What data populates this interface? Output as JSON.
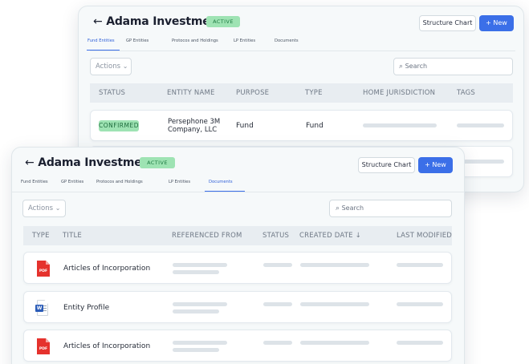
{
  "back_card": {
    "title": "Adama Investments",
    "back_arrow": "←",
    "badge": "ACTIVE",
    "structure_chart_label": "Structure Chart",
    "new_label": "+ New",
    "tabs": [
      {
        "label": "Fund Entities",
        "active": true
      },
      {
        "label": "GP Entities",
        "active": false
      },
      {
        "label": "Protocos and Holdings",
        "active": false
      },
      {
        "label": "LP Entities",
        "active": false
      },
      {
        "label": "Documents",
        "active": false
      }
    ],
    "actions_label": "Actions",
    "actions_chevron": "⌄",
    "search_icon": "⌕",
    "search_placeholder": "Search",
    "columns": [
      "STATUS",
      "ENTITY NAME",
      "PURPOSE",
      "TYPE",
      "HOME JURISDICTION",
      "TAGS"
    ],
    "rows": [
      {
        "status": "CONFIRMED",
        "entity_name_line1": "Persephone 3M",
        "entity_name_line2": "Company, LLC",
        "purpose": "Fund",
        "type": "Fund"
      }
    ]
  },
  "front_card": {
    "title": "Adama Investments",
    "back_arrow": "←",
    "badge": "ACTIVE",
    "structure_chart_label": "Structure Chart",
    "new_label": "+ New",
    "tabs": [
      {
        "label": "Fund Entities",
        "active": false
      },
      {
        "label": "GP Entities",
        "active": false
      },
      {
        "label": "Protocos and Holdings",
        "active": false
      },
      {
        "label": "LP Entities",
        "active": false
      },
      {
        "label": "Documents",
        "active": true
      }
    ],
    "actions_label": "Actions",
    "actions_chevron": "⌄",
    "search_icon": "⌕",
    "search_placeholder": "Search",
    "columns": [
      "TYPE",
      "TITLE",
      "REFERENCED FROM",
      "STATUS",
      "CREATED DATE ↓",
      "LAST MODIFIED"
    ],
    "rows": [
      {
        "type_icon": "pdf-icon",
        "type_label": "PDF",
        "title": "Articles of Incorporation"
      },
      {
        "type_icon": "word-doc-icon",
        "type_label": "W",
        "title": "Entity Profile"
      },
      {
        "type_icon": "pdf-icon",
        "type_label": "PDF",
        "title": "Articles of Incorporation"
      }
    ]
  },
  "colors": {
    "accent": "#3b6fe8",
    "badge_bg": "#9ee3b3",
    "badge_text": "#1d7a42",
    "pdf_red": "#e5322d",
    "word_blue": "#2b5cb8",
    "skeleton": "#dde3e8"
  }
}
